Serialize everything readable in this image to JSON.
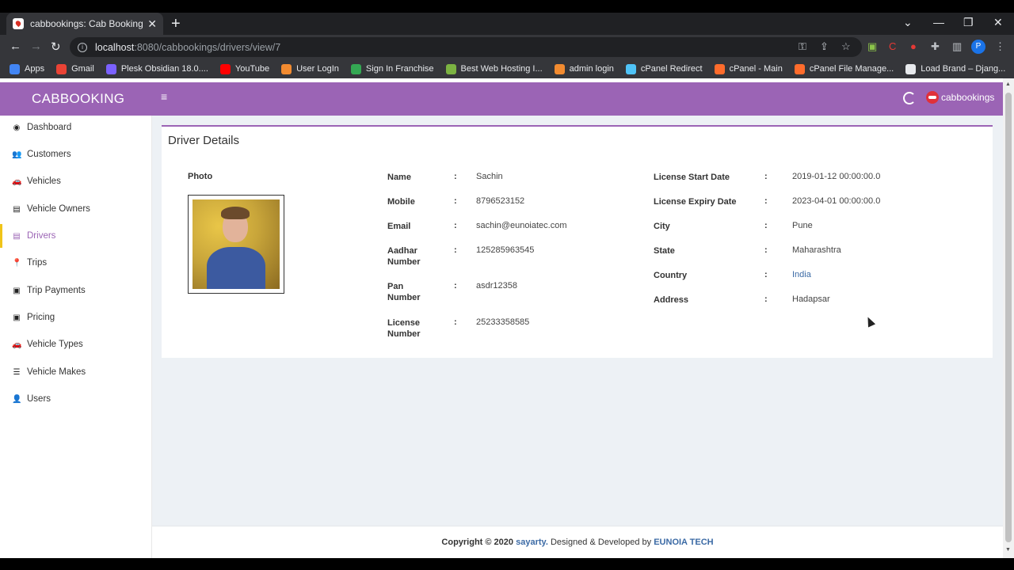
{
  "browser": {
    "tab_title": "cabbookings: Cab Booking and R",
    "url_host": "localhost",
    "url_path": ":8080/cabbookings/drivers/view/7",
    "profile_initial": "P",
    "bookmarks": [
      {
        "label": "Apps",
        "color": "#4285f4"
      },
      {
        "label": "Gmail",
        "color": "#ea4335"
      },
      {
        "label": "Plesk Obsidian 18.0....",
        "color": "#7b61ff"
      },
      {
        "label": "YouTube",
        "color": "#ff0000"
      },
      {
        "label": "User LogIn",
        "color": "#f28b30"
      },
      {
        "label": "Sign In Franchise",
        "color": "#34a853"
      },
      {
        "label": "Best Web Hosting I...",
        "color": "#7cb342"
      },
      {
        "label": "admin login",
        "color": "#f28b30"
      },
      {
        "label": "cPanel Redirect",
        "color": "#4fc3f7"
      },
      {
        "label": "cPanel - Main",
        "color": "#ff6c2c"
      },
      {
        "label": "cPanel File Manage...",
        "color": "#ff6c2c"
      },
      {
        "label": "Load Brand – Djang...",
        "color": "#e8eaed"
      }
    ]
  },
  "header": {
    "brand": "CABBOOKING",
    "logo_text": "cabbookings",
    "accent": "#9b64b5"
  },
  "sidebar": {
    "items": [
      {
        "label": "Dashboard",
        "icon": "dashboard-icon",
        "glyph": "◉"
      },
      {
        "label": "Customers",
        "icon": "users-icon",
        "glyph": "👥"
      },
      {
        "label": "Vehicles",
        "icon": "car-icon",
        "glyph": "🚗"
      },
      {
        "label": "Vehicle Owners",
        "icon": "id-card-icon",
        "glyph": "▤"
      },
      {
        "label": "Drivers",
        "icon": "id-card-icon",
        "glyph": "▤"
      },
      {
        "label": "Trips",
        "icon": "map-pin-icon",
        "glyph": "📍"
      },
      {
        "label": "Trip Payments",
        "icon": "money-icon",
        "glyph": "▣"
      },
      {
        "label": "Pricing",
        "icon": "money-icon",
        "glyph": "▣"
      },
      {
        "label": "Vehicle Types",
        "icon": "car-icon",
        "glyph": "🚗"
      },
      {
        "label": "Vehicle Makes",
        "icon": "list-icon",
        "glyph": "☰"
      },
      {
        "label": "Users",
        "icon": "user-icon",
        "glyph": "👤"
      }
    ],
    "active": "Drivers"
  },
  "card": {
    "title": "Driver Details",
    "photo_label": "Photo",
    "left_fields": [
      {
        "label": "Name",
        "value": "Sachin"
      },
      {
        "label": "Mobile",
        "value": "8796523152"
      },
      {
        "label": "Email",
        "value": "sachin@eunoiatec.com"
      },
      {
        "label": "Aadhar Number",
        "value": "125285963545"
      },
      {
        "label": "Pan Number",
        "value": "asdr12358"
      },
      {
        "label": "License Number",
        "value": "25233358585"
      }
    ],
    "right_fields": [
      {
        "label": "License Start Date",
        "value": "2019-01-12 00:00:00.0"
      },
      {
        "label": "License Expiry Date",
        "value": "2023-04-01 00:00:00.0"
      },
      {
        "label": "City",
        "value": "Pune"
      },
      {
        "label": "State",
        "value": "Maharashtra"
      },
      {
        "label": "Country",
        "value": "India"
      },
      {
        "label": "Address",
        "value": "Hadapsar"
      }
    ],
    "separator": ":"
  },
  "footer": {
    "prefix": "Copyright © 2020",
    "brand": "sayarty.",
    "middle": "Designed & Developed by",
    "company": "EUNOIA TECH"
  }
}
